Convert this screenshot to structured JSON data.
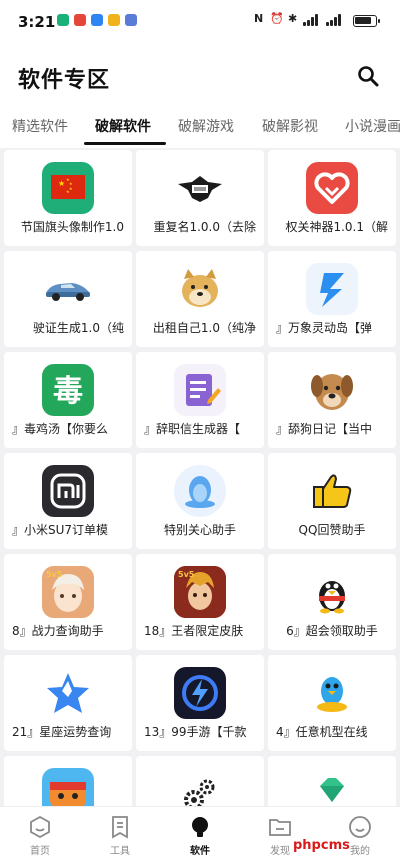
{
  "status_bar": {
    "time": "3:21",
    "network_label": "N"
  },
  "header": {
    "title": "软件专区"
  },
  "tabs": [
    {
      "label": "精选软件"
    },
    {
      "label": "破解软件"
    },
    {
      "label": "破解游戏"
    },
    {
      "label": "破解影视"
    },
    {
      "label": "小说漫画"
    }
  ],
  "active_tab": "破解软件",
  "apps": [
    {
      "label": "节国旗头像制作1.0",
      "icon": "china-flag-icon"
    },
    {
      "label": "重复名1.0.0（去除",
      "icon": "eagle-emblem-icon"
    },
    {
      "label": "权关神器1.0.1（解",
      "icon": "heart-badge-icon"
    },
    {
      "label": "驶证生成1.0（纯",
      "icon": "sports-car-icon"
    },
    {
      "label": "出租自己1.0（纯净",
      "icon": "doge-icon"
    },
    {
      "label": "』万象灵动岛【弹",
      "icon": "dynamic-island-icon"
    },
    {
      "label": "』毒鸡汤【你要么",
      "icon": "poison-character-icon"
    },
    {
      "label": "』辞职信生成器【",
      "icon": "letter-edit-icon"
    },
    {
      "label": "』舔狗日记【当中",
      "icon": "dog-photo-icon"
    },
    {
      "label": "』小米SU7订单模",
      "icon": "xiaomi-logo-icon"
    },
    {
      "label": "特别关心助手",
      "icon": "qq-penguin-icon"
    },
    {
      "label": "QQ回赞助手",
      "icon": "thumbs-up-icon"
    },
    {
      "label": "8』战力查询助手",
      "icon": "game-hero-icon"
    },
    {
      "label": "18』王者限定皮肤",
      "icon": "game-warrior-icon"
    },
    {
      "label": "6』超会领取助手",
      "icon": "qq-red-penguin-icon"
    },
    {
      "label": "21』星座运势查询",
      "icon": "star-icon"
    },
    {
      "label": "13』99手游【千款",
      "icon": "lightning-circle-icon"
    },
    {
      "label": "4』任意机型在线",
      "icon": "qq-blue-penguin-icon"
    },
    {
      "label": "",
      "icon": "game-character-icon"
    },
    {
      "label": "",
      "icon": "gears-icon"
    },
    {
      "label": "",
      "icon": "green-diamond-icon"
    }
  ],
  "bottom_nav": [
    {
      "label": "首页",
      "icon": "home-icon"
    },
    {
      "label": "工具",
      "icon": "tools-icon"
    },
    {
      "label": "软件",
      "icon": "software-icon"
    },
    {
      "label": "发现",
      "icon": "discover-icon"
    },
    {
      "label": "我的",
      "icon": "profile-icon"
    }
  ],
  "watermark": "phpcms",
  "colors": {
    "background": "#f1f1f3",
    "card": "#ffffff",
    "accent": "#111111",
    "watermark": "#d81a1a"
  }
}
